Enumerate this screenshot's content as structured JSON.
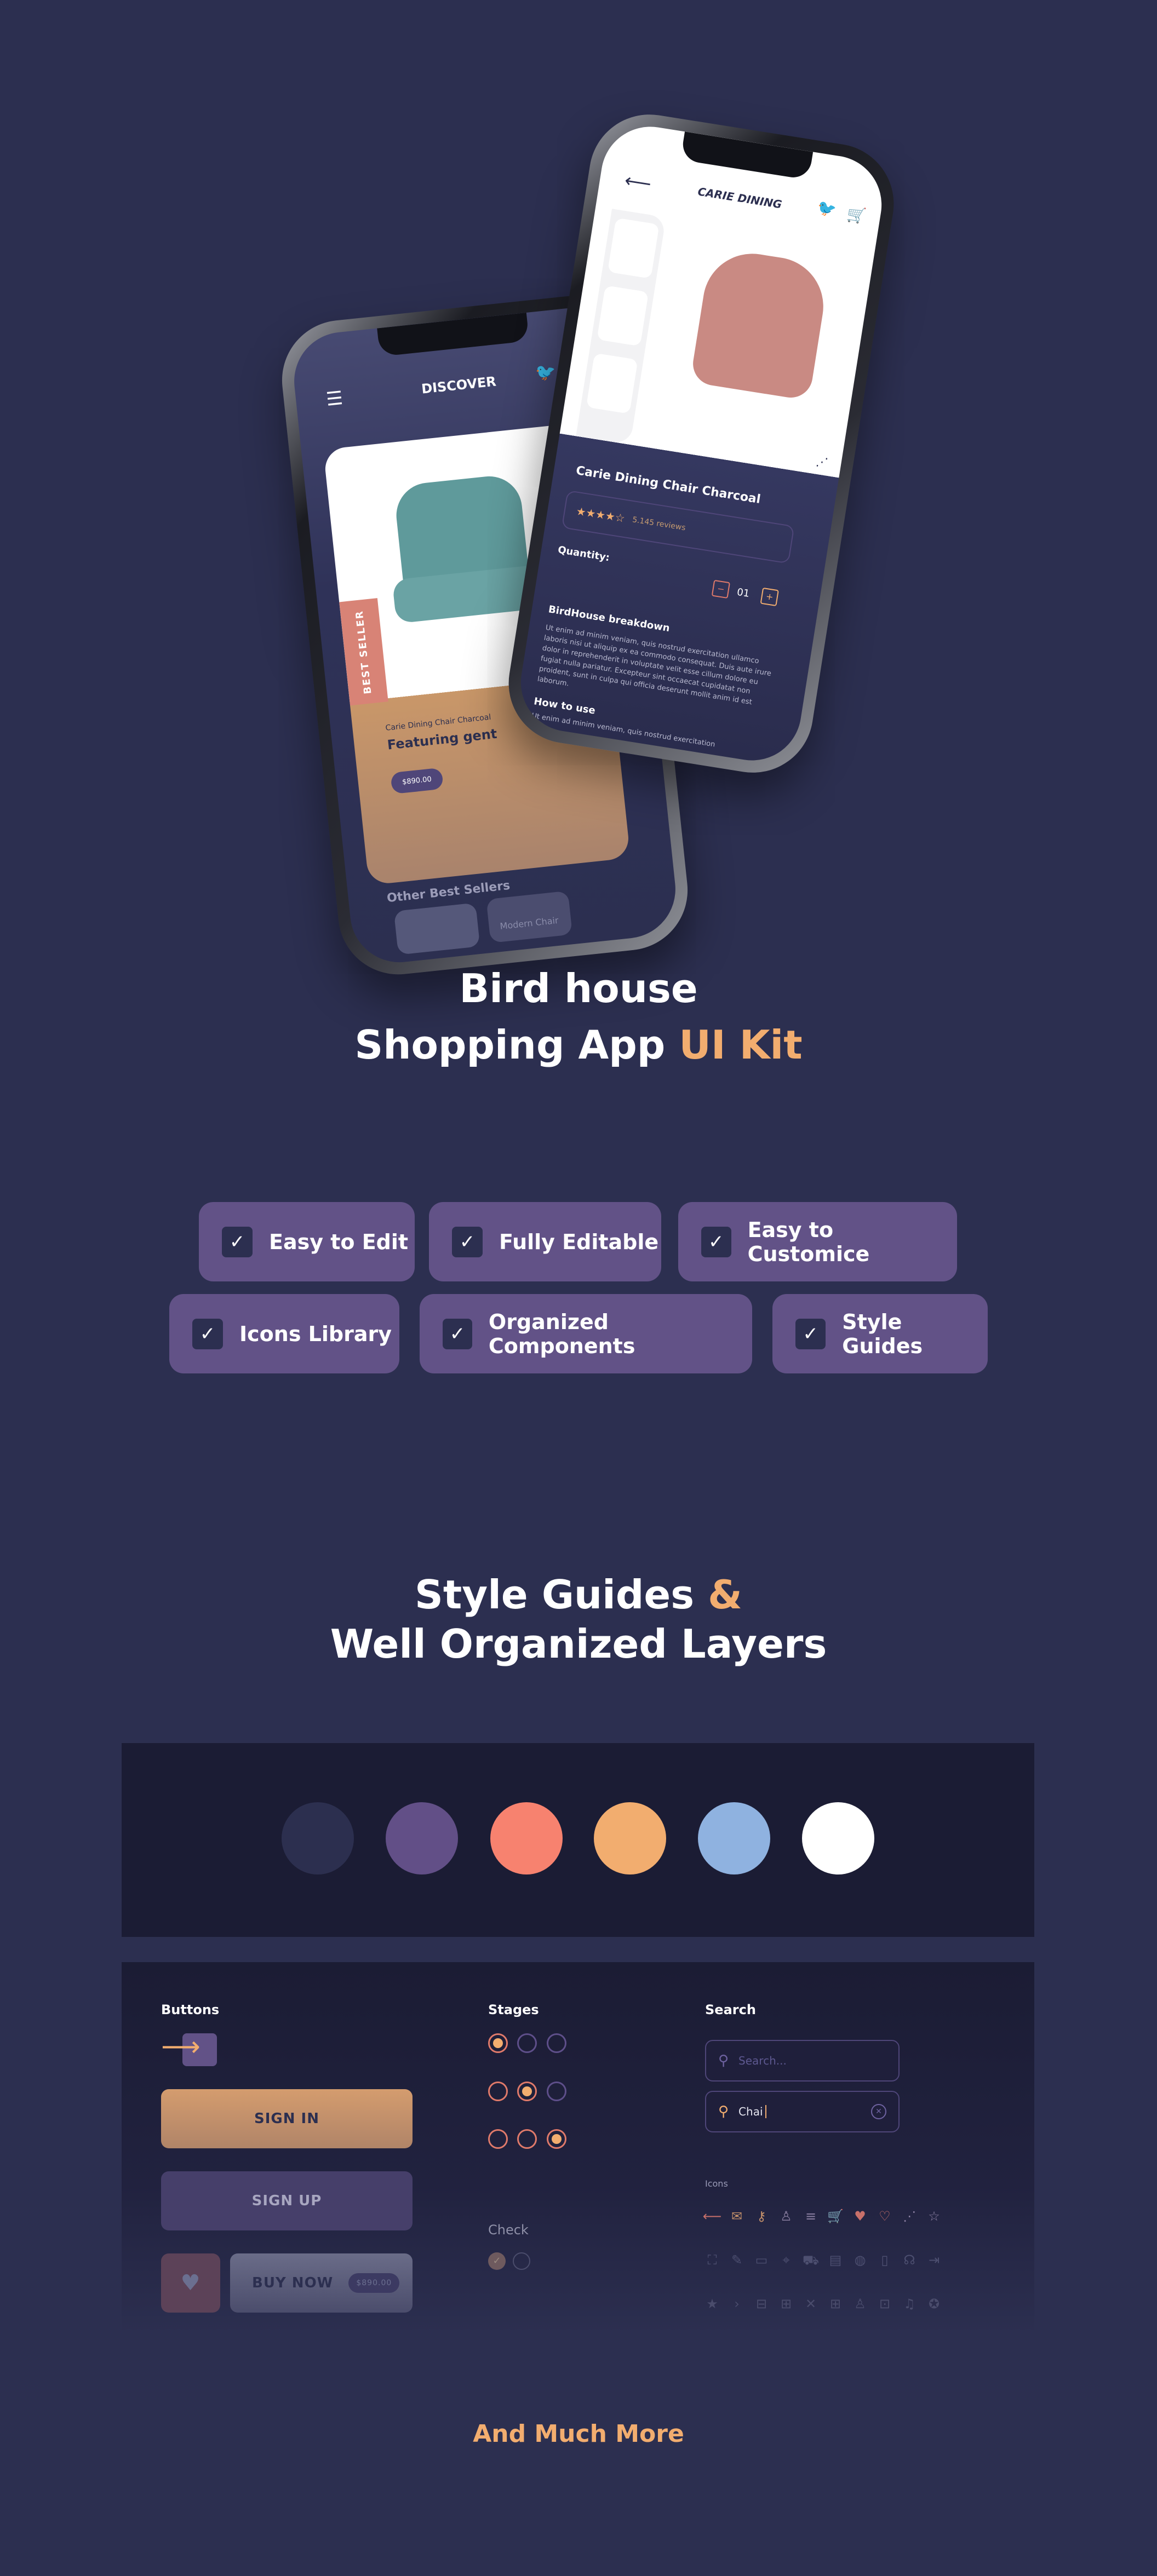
{
  "hero": {
    "left_phone": {
      "header_title": "DISCOVER",
      "badge": "BEST SELLER",
      "product_subtitle": "Carie Dining Chair Charcoal",
      "product_title": "Featuring gent",
      "price": "$890.00",
      "section_title": "Other Best Sellers",
      "item_label": "Modern Chair"
    },
    "right_phone": {
      "header_title": "CARIE DINING",
      "product_name": "Carie Dining Chair Charcoal",
      "rating": 4,
      "reviews": "5.145 reviews",
      "quantity_label": "Quantity:",
      "quantity": "01",
      "breakdown_title": "BirdHouse breakdown",
      "breakdown_text": "Ut enim ad minim veniam, quis nostrud exercitation ullamco laboris nisi ut aliquip ex ea commodo consequat. Duis aute irure dolor in reprehenderit in voluptate velit esse cillum dolore eu fugiat nulla pariatur. Excepteur sint occaecat cupidatat non proident, sunt in culpa qui officia deserunt mollit anim id est laborum.",
      "how_to_use": "How to use",
      "how_to_text": "Ut enim ad minim veniam, quis nostrud exercitation"
    }
  },
  "headline": {
    "line1": "Bird house",
    "line2_main": "Shopping App ",
    "line2_accent": "UI Kit"
  },
  "features": [
    "Easy to Edit",
    "Fully Editable",
    "Easy to Customice",
    "Icons Library",
    "Organized Components",
    "Style Guides"
  ],
  "section2": {
    "line1_main": "Style Guides ",
    "line1_accent": "&",
    "line2": "Well Organized Layers"
  },
  "palette": [
    "#2c2f4f",
    "#624f87",
    "#f7826f",
    "#f2ad6f",
    "#8fb2e0",
    "#ffffff"
  ],
  "components": {
    "buttons_label": "Buttons",
    "sign_in": "SIGN IN",
    "sign_up": "SIGN UP",
    "buy_now": "BUY NOW",
    "buy_price": "$890.00",
    "stages_label": "Stages",
    "check_label": "Check",
    "search_label": "Search",
    "search_placeholder": "Search...",
    "search_value": "Chai",
    "icons_label": "Icons",
    "icons": [
      [
        "arrow-left",
        "mail",
        "key",
        "user",
        "menu",
        "cart",
        "heart-filled",
        "heart",
        "share",
        "star"
      ],
      [
        "scan",
        "edit",
        "ticket",
        "location",
        "truck",
        "card",
        "globe",
        "phone",
        "headphones",
        "logout"
      ],
      [
        "star-filled",
        "chevron-right",
        "minus",
        "plus",
        "close",
        "grid",
        "users",
        "gift",
        "bell",
        "award"
      ]
    ]
  },
  "footer": "And Much More",
  "colors": {
    "background": "#2c2f50",
    "accent": "#f2ad6f",
    "pill": "#625287",
    "panel": "#1b1c34"
  }
}
